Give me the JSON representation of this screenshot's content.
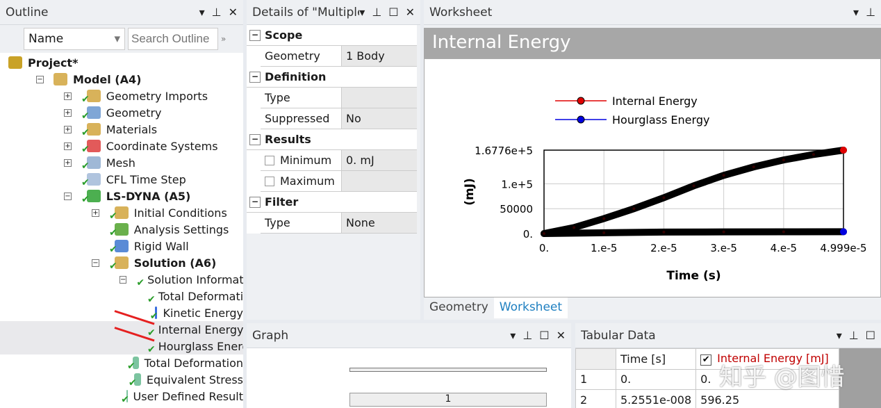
{
  "outline": {
    "title": "Outline",
    "filter": "Name",
    "search_placeholder": "Search Outline",
    "items": [
      {
        "label": "Project*",
        "bold": true,
        "depth": 0,
        "exp": "",
        "icon": "#c9a227"
      },
      {
        "label": "Model (A4)",
        "bold": true,
        "depth": 1,
        "exp": "−",
        "icon": "#d8b25a"
      },
      {
        "label": "Geometry Imports",
        "depth": 2,
        "exp": "+",
        "check": true,
        "icon": "#d8b25a"
      },
      {
        "label": "Geometry",
        "depth": 2,
        "exp": "+",
        "check": true,
        "icon": "#7fa6d6"
      },
      {
        "label": "Materials",
        "depth": 2,
        "exp": "+",
        "check": true,
        "icon": "#d8b25a"
      },
      {
        "label": "Coordinate Systems",
        "depth": 2,
        "exp": "+",
        "check": true,
        "icon": "#e25a5a"
      },
      {
        "label": "Mesh",
        "depth": 2,
        "exp": "+",
        "check": true,
        "icon": "#9fb8d6"
      },
      {
        "label": "CFL Time Step",
        "depth": 2,
        "exp": "",
        "check": true,
        "icon": "#b0c4de"
      },
      {
        "label": "LS-DYNA (A5)",
        "bold": true,
        "depth": 2,
        "exp": "−",
        "check": true,
        "icon": "#4caf50"
      },
      {
        "label": "Initial Conditions",
        "depth": 3,
        "exp": "+",
        "check": true,
        "icon": "#d8b25a"
      },
      {
        "label": "Analysis Settings",
        "depth": 3,
        "exp": "",
        "check": true,
        "icon": "#6ab04c"
      },
      {
        "label": "Rigid Wall",
        "depth": 3,
        "exp": "",
        "check": true,
        "icon": "#5a8bd6"
      },
      {
        "label": "Solution (A6)",
        "bold": true,
        "depth": 3,
        "exp": "−",
        "check": true,
        "icon": "#d8b25a"
      },
      {
        "label": "Solution Information",
        "depth": 4,
        "exp": "−",
        "check": true,
        "icon": "#e8d88a"
      },
      {
        "label": "Total Deformation",
        "depth": 5,
        "exp": "",
        "check": true,
        "icon": "#6aa6d6"
      },
      {
        "label": "Kinetic Energy",
        "depth": 5,
        "exp": "",
        "check": true,
        "icon": "#3a6ee0"
      },
      {
        "label": "Internal Energy",
        "depth": 5,
        "exp": "",
        "check": true,
        "icon": "#3a6ee0",
        "selected": true
      },
      {
        "label": "Hourglass Energy",
        "depth": 5,
        "exp": "",
        "check": true,
        "icon": "#3a6ee0",
        "selected": true
      },
      {
        "label": "Total Deformation",
        "depth": 4,
        "exp": "",
        "check": true,
        "icon": "#7cc4a0"
      },
      {
        "label": "Equivalent Stress",
        "depth": 4,
        "exp": "",
        "check": true,
        "icon": "#7cc4a0"
      },
      {
        "label": "User Defined Result",
        "depth": 4,
        "exp": "",
        "check": true,
        "icon": "#7cc4a0"
      }
    ]
  },
  "details": {
    "title": "Details of \"Multiple Selection\"",
    "groups": [
      {
        "name": "Scope",
        "rows": [
          {
            "k": "Geometry",
            "v": "1 Body"
          }
        ]
      },
      {
        "name": "Definition",
        "rows": [
          {
            "k": "Type",
            "v": ""
          },
          {
            "k": "Suppressed",
            "v": "No"
          }
        ]
      },
      {
        "name": "Results",
        "rows": [
          {
            "k": "Minimum",
            "v": "0. mJ",
            "cb": true
          },
          {
            "k": "Maximum",
            "v": "",
            "cb": true
          }
        ]
      },
      {
        "name": "Filter",
        "rows": [
          {
            "k": "Type",
            "v": "None"
          }
        ]
      }
    ]
  },
  "worksheet": {
    "title": "Worksheet",
    "heading": "Internal Energy",
    "tabs": [
      "Geometry",
      "Worksheet"
    ],
    "active_tab": "Worksheet"
  },
  "chart_data": {
    "type": "line",
    "xlabel": "Time (s)",
    "ylabel": "(mJ)",
    "xlim": [
      0,
      4.999e-05
    ],
    "ylim": [
      0,
      167760
    ],
    "xticks": [
      "0.",
      "1.e-5",
      "2.e-5",
      "3.e-5",
      "4.e-5",
      "4.999e-5"
    ],
    "xtick_values": [
      0,
      1e-05,
      2e-05,
      3e-05,
      4e-05,
      4.999e-05
    ],
    "yticks": [
      "0.",
      "50000",
      "1.e+5",
      "1.6776e+5"
    ],
    "ytick_values": [
      0,
      50000,
      100000,
      167760
    ],
    "grid": true,
    "legend": "top-left",
    "series": [
      {
        "name": "Internal Energy",
        "color": "#e00000",
        "x": [
          0,
          5e-06,
          1e-05,
          1.5e-05,
          2e-05,
          2.5e-05,
          3e-05,
          3.5e-05,
          4e-05,
          4.5e-05,
          4.999e-05
        ],
        "y": [
          0,
          12000,
          30000,
          50000,
          72000,
          96000,
          117000,
          134000,
          148000,
          159000,
          167760
        ]
      },
      {
        "name": "Hourglass Energy",
        "color": "#0000e0",
        "x": [
          0,
          1e-05,
          2e-05,
          3e-05,
          4e-05,
          4.999e-05
        ],
        "y": [
          0,
          1500,
          3000,
          3300,
          3500,
          3600
        ]
      }
    ]
  },
  "graph": {
    "title": "Graph",
    "animation_frame": "1"
  },
  "tabular": {
    "title": "Tabular Data",
    "columns": [
      "Time [s]",
      "Internal Energy [mJ]"
    ],
    "rows": [
      [
        "1",
        "0.",
        "0."
      ],
      [
        "2",
        "5.2551e-008",
        "596.25"
      ]
    ]
  },
  "watermark": "知乎 @图惜"
}
